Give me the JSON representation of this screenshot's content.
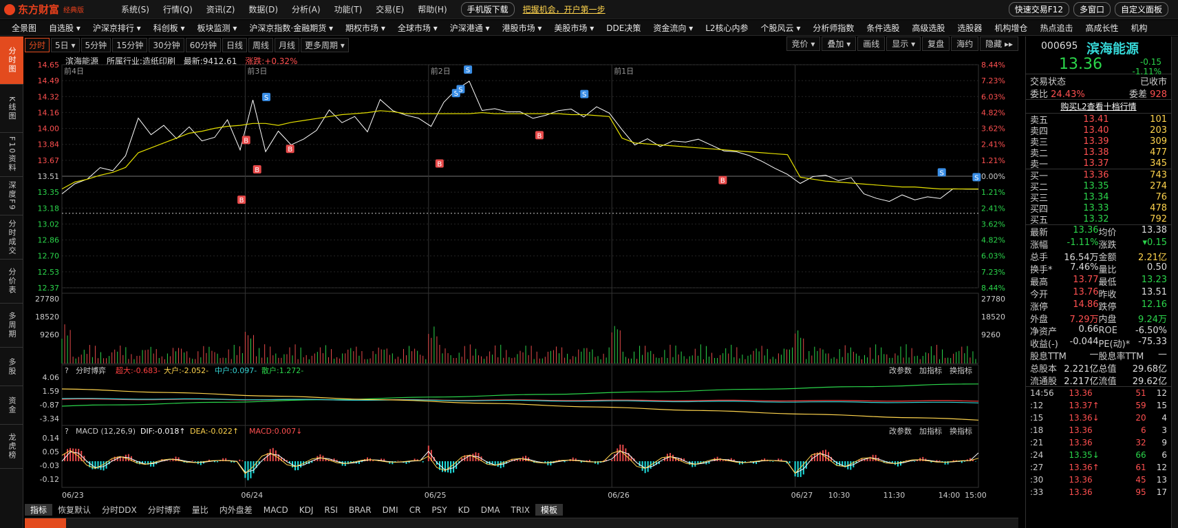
{
  "app": {
    "logo": "东方财富",
    "edition": "经典版"
  },
  "menu": {
    "items": [
      "系统(S)",
      "行情(Q)",
      "资讯(Z)",
      "数据(D)",
      "分析(A)",
      "功能(T)",
      "交易(E)",
      "帮助(H)"
    ],
    "mobile_btn": "手机版下载",
    "promo": "把握机会，开户第一步",
    "right": [
      "快速交易F12",
      "多窗口",
      "自定义面板"
    ]
  },
  "nav": [
    "全景图",
    "自选股 ▾",
    "沪深京排行 ▾",
    "科创板 ▾",
    "板块监测 ▾",
    "沪深京指数·金融期货 ▾",
    "期权市场 ▾",
    "全球市场 ▾",
    "沪深港通 ▾",
    "港股市场 ▾",
    "美股市场 ▾",
    "DDE决策",
    "资金流向 ▾",
    "L2核心内参",
    "个股风云 ▾",
    "分析师指数",
    "条件选股",
    "高级选股",
    "选股器",
    "机构增仓",
    "热点追击",
    "高成长性",
    "机构"
  ],
  "left_tabs": [
    "分时图",
    "K线图",
    "F10资料",
    "深度F9",
    "分时成交",
    "分价表",
    "多周期",
    "多股",
    "资金",
    "龙虎榜"
  ],
  "period": {
    "buttons": [
      "分时",
      "5日 ▾",
      "5分钟",
      "15分钟",
      "30分钟",
      "60分钟",
      "日线",
      "周线",
      "月线",
      "更多周期 ▾"
    ],
    "tools": [
      "竞价 ▾",
      "叠加 ▾",
      "画线",
      "显示 ▾",
      "复盘",
      "海约",
      "隐藏 ▸▸"
    ]
  },
  "info": {
    "name": "滨海能源",
    "industry": "所属行业:造纸印刷",
    "latest": "最新:9412.61",
    "change": "涨跌:+0.32%"
  },
  "chart_data": [
    {
      "type": "line",
      "name": "price",
      "days": [
        "前4日",
        "前3日",
        "前2日",
        "前1日",
        ""
      ],
      "x_labels": [
        "06/23",
        "06/24",
        "06/25",
        "06/26",
        "06/27",
        "10:30",
        "11:30",
        "14:00",
        "15:00"
      ],
      "ylim": [
        12.37,
        14.65
      ],
      "y_ticks": [
        "14.65",
        "14.49",
        "14.32",
        "14.16",
        "14.00",
        "13.84",
        "13.67",
        "13.51",
        "13.35",
        "13.18",
        "13.02",
        "12.86",
        "12.70",
        "12.53",
        "12.37"
      ],
      "pct_ticks": [
        "8.44%",
        "7.23%",
        "6.03%",
        "4.82%",
        "3.62%",
        "2.41%",
        "1.21%",
        "0.00%",
        "1.21%",
        "2.41%",
        "3.62%",
        "4.82%",
        "6.03%",
        "7.23%",
        "8.44%"
      ],
      "series": [
        {
          "values": [
            13.33,
            13.45,
            13.5,
            13.6,
            13.55,
            13.7,
            14.1,
            13.95,
            14.05,
            13.9,
            14.0,
            13.85,
            13.9,
            14.1,
            13.8,
            14.3,
            13.75,
            13.95,
            13.82,
            13.9,
            14.0,
            14.2,
            14.05,
            14.1,
            13.95,
            14.3,
            14.2,
            14.15,
            14.1,
            14.0,
            14.25,
            14.4,
            14.5,
            14.2,
            14.2,
            14.15,
            14.15,
            14.1,
            14.15,
            14.2,
            14.2,
            14.1,
            14.2,
            14.15,
            14.0,
            13.85,
            13.9,
            13.8,
            13.85,
            13.85,
            13.9,
            13.85,
            13.78,
            13.75,
            13.7,
            13.65,
            13.6,
            13.55,
            13.45,
            13.5,
            13.5,
            13.45,
            13.5,
            13.35,
            13.3,
            13.25,
            13.3,
            13.25,
            13.3,
            13.3,
            13.4,
            13.38,
            13.36
          ]
        },
        {
          "values": [
            13.38,
            13.45,
            13.48,
            13.52,
            13.55,
            13.6,
            13.75,
            13.8,
            13.85,
            13.9,
            13.95,
            13.97,
            14.0,
            14.02,
            14.03,
            14.05,
            14.05,
            14.03,
            14.06,
            14.08,
            14.1,
            14.12,
            14.14,
            14.15,
            14.16,
            14.18,
            14.17,
            14.15,
            14.15,
            14.15,
            14.15,
            14.15,
            14.15,
            14.16,
            14.15,
            14.15,
            14.15,
            14.15,
            14.15,
            14.15,
            14.14,
            14.14,
            14.13,
            14.12,
            13.9,
            13.85,
            13.84,
            13.83,
            13.82,
            13.81,
            13.8,
            13.79,
            13.78,
            13.77,
            13.76,
            13.75,
            13.74,
            13.73,
            13.5,
            13.48,
            13.46,
            13.45,
            13.44,
            13.43,
            13.42,
            13.41,
            13.4,
            13.4,
            13.39,
            13.38,
            13.38,
            13.38,
            13.38
          ]
        }
      ],
      "signals": [
        {
          "t": "B",
          "x": 0.196,
          "y": 13.27
        },
        {
          "t": "B",
          "x": 0.201,
          "y": 13.88
        },
        {
          "t": "B",
          "x": 0.213,
          "y": 13.58
        },
        {
          "t": "S",
          "x": 0.223,
          "y": 14.32
        },
        {
          "t": "B",
          "x": 0.249,
          "y": 13.79
        },
        {
          "t": "B",
          "x": 0.412,
          "y": 13.64
        },
        {
          "t": "S",
          "x": 0.43,
          "y": 14.36
        },
        {
          "t": "S",
          "x": 0.435,
          "y": 14.4
        },
        {
          "t": "S",
          "x": 0.443,
          "y": 14.6
        },
        {
          "t": "B",
          "x": 0.521,
          "y": 13.93
        },
        {
          "t": "S",
          "x": 0.57,
          "y": 14.35
        },
        {
          "t": "B",
          "x": 0.721,
          "y": 13.47
        },
        {
          "t": "S",
          "x": 0.96,
          "y": 13.55
        },
        {
          "t": "S",
          "x": 0.998,
          "y": 13.5
        }
      ]
    },
    {
      "type": "bar",
      "name": "volume",
      "y_ticks": [
        "27780",
        "18520",
        "9260"
      ]
    },
    {
      "type": "line",
      "name": "分时博弈",
      "legend": [
        "?",
        "分时博弈",
        "超大:-0.683-",
        "大户:-2.052-",
        "中户:0.097-",
        "散户:1.272-"
      ],
      "y_ticks": [
        "4.06",
        "1.59",
        "-0.87",
        "-3.34"
      ],
      "btns": [
        "改参数",
        "加指标",
        "换指标"
      ]
    },
    {
      "type": "bar",
      "name": "MACD",
      "legend": [
        "?",
        "MACD (12,26,9)",
        "DIF:-0.018↑",
        "DEA:-0.022↑",
        "MACD:0.007↓"
      ],
      "y_ticks": [
        "0.14",
        "0.05",
        "-0.03",
        "-0.12"
      ],
      "btns": [
        "改参数",
        "加指标",
        "换指标"
      ]
    }
  ],
  "bottom": {
    "buttons": [
      "指标",
      "恢复默认",
      "分时DDX",
      "分时博弈",
      "量比",
      "内外盘差",
      "MACD",
      "KDJ",
      "RSI",
      "BRAR",
      "DMI",
      "CR",
      "PSY",
      "KD",
      "DMA",
      "TRIX",
      "模板"
    ]
  },
  "quote": {
    "code": "000695",
    "name": "滨海能源",
    "price": "13.36",
    "chg": "-0.15",
    "pct": "-1.11%",
    "status_label": "交易状态",
    "status": "已收市",
    "ratio_label": "委比",
    "ratio": "24.43%",
    "diff_label": "委差",
    "diff": "928",
    "l2": "购买L2查看十档行情",
    "asks": [
      {
        "l": "卖五",
        "p": "13.41",
        "v": "101"
      },
      {
        "l": "卖四",
        "p": "13.40",
        "v": "203"
      },
      {
        "l": "卖三",
        "p": "13.39",
        "v": "309"
      },
      {
        "l": "卖二",
        "p": "13.38",
        "v": "477"
      },
      {
        "l": "卖一",
        "p": "13.37",
        "v": "345"
      }
    ],
    "bids": [
      {
        "l": "买一",
        "p": "13.36",
        "v": "743"
      },
      {
        "l": "买二",
        "p": "13.35",
        "v": "274"
      },
      {
        "l": "买三",
        "p": "13.34",
        "v": "76"
      },
      {
        "l": "买四",
        "p": "13.33",
        "v": "478"
      },
      {
        "l": "买五",
        "p": "13.32",
        "v": "792"
      }
    ],
    "stats": [
      [
        [
          "最新",
          "13.36",
          "grn"
        ],
        [
          "均价",
          "13.38",
          ""
        ]
      ],
      [
        [
          "涨幅",
          "-1.11%",
          "grn"
        ],
        [
          "涨跌",
          "▾0.15",
          "grn"
        ]
      ],
      [
        [
          "总手",
          "16.54万",
          ""
        ],
        [
          "金额",
          "2.21亿",
          "yel"
        ]
      ],
      [
        [
          "换手*",
          "7.46%",
          ""
        ],
        [
          "量比",
          "0.50",
          ""
        ]
      ],
      [
        [
          "最高",
          "13.77",
          "red"
        ],
        [
          "最低",
          "13.23",
          "grn"
        ]
      ],
      [
        [
          "今开",
          "13.76",
          "red"
        ],
        [
          "昨收",
          "13.51",
          ""
        ]
      ],
      [
        [
          "涨停",
          "14.86",
          "red"
        ],
        [
          "跌停",
          "12.16",
          "grn"
        ]
      ],
      [
        [
          "外盘",
          "7.29万",
          "red"
        ],
        [
          "内盘",
          "9.24万",
          "grn"
        ]
      ],
      [
        [
          "净资产",
          "0.66",
          ""
        ],
        [
          "ROE",
          "-6.50%",
          ""
        ]
      ],
      [
        [
          "收益(-)",
          "-0.044",
          ""
        ],
        [
          "PE(动)*",
          "-75.33",
          ""
        ]
      ],
      [
        [
          "股息TTM",
          "—",
          ""
        ],
        [
          "股息率TTM",
          "—",
          ""
        ]
      ],
      [
        [
          "总股本",
          "2.221亿",
          ""
        ],
        [
          "总值",
          "29.68亿",
          ""
        ]
      ],
      [
        [
          "流通股",
          "2.217亿",
          ""
        ],
        [
          "流值",
          "29.62亿",
          ""
        ]
      ]
    ],
    "ticks": [
      {
        "t": "14:56",
        "p": "13.36",
        "v": "51",
        "n": "12",
        "c": "red"
      },
      {
        "t": ":12",
        "p": "13.37↑",
        "v": "59",
        "n": "15",
        "c": "red"
      },
      {
        "t": ":15",
        "p": "13.36↓",
        "v": "20",
        "n": "4",
        "c": "red"
      },
      {
        "t": ":18",
        "p": "13.36",
        "v": "6",
        "n": "3",
        "c": "red"
      },
      {
        "t": ":21",
        "p": "13.36",
        "v": "32",
        "n": "9",
        "c": "red"
      },
      {
        "t": ":24",
        "p": "13.35↓",
        "v": "66",
        "n": "6",
        "c": "grn"
      },
      {
        "t": ":27",
        "p": "13.36↑",
        "v": "61",
        "n": "12",
        "c": "red"
      },
      {
        "t": ":30",
        "p": "13.36",
        "v": "45",
        "n": "13",
        "c": "red"
      },
      {
        "t": ":33",
        "p": "13.36",
        "v": "95",
        "n": "17",
        "c": "red"
      }
    ]
  }
}
